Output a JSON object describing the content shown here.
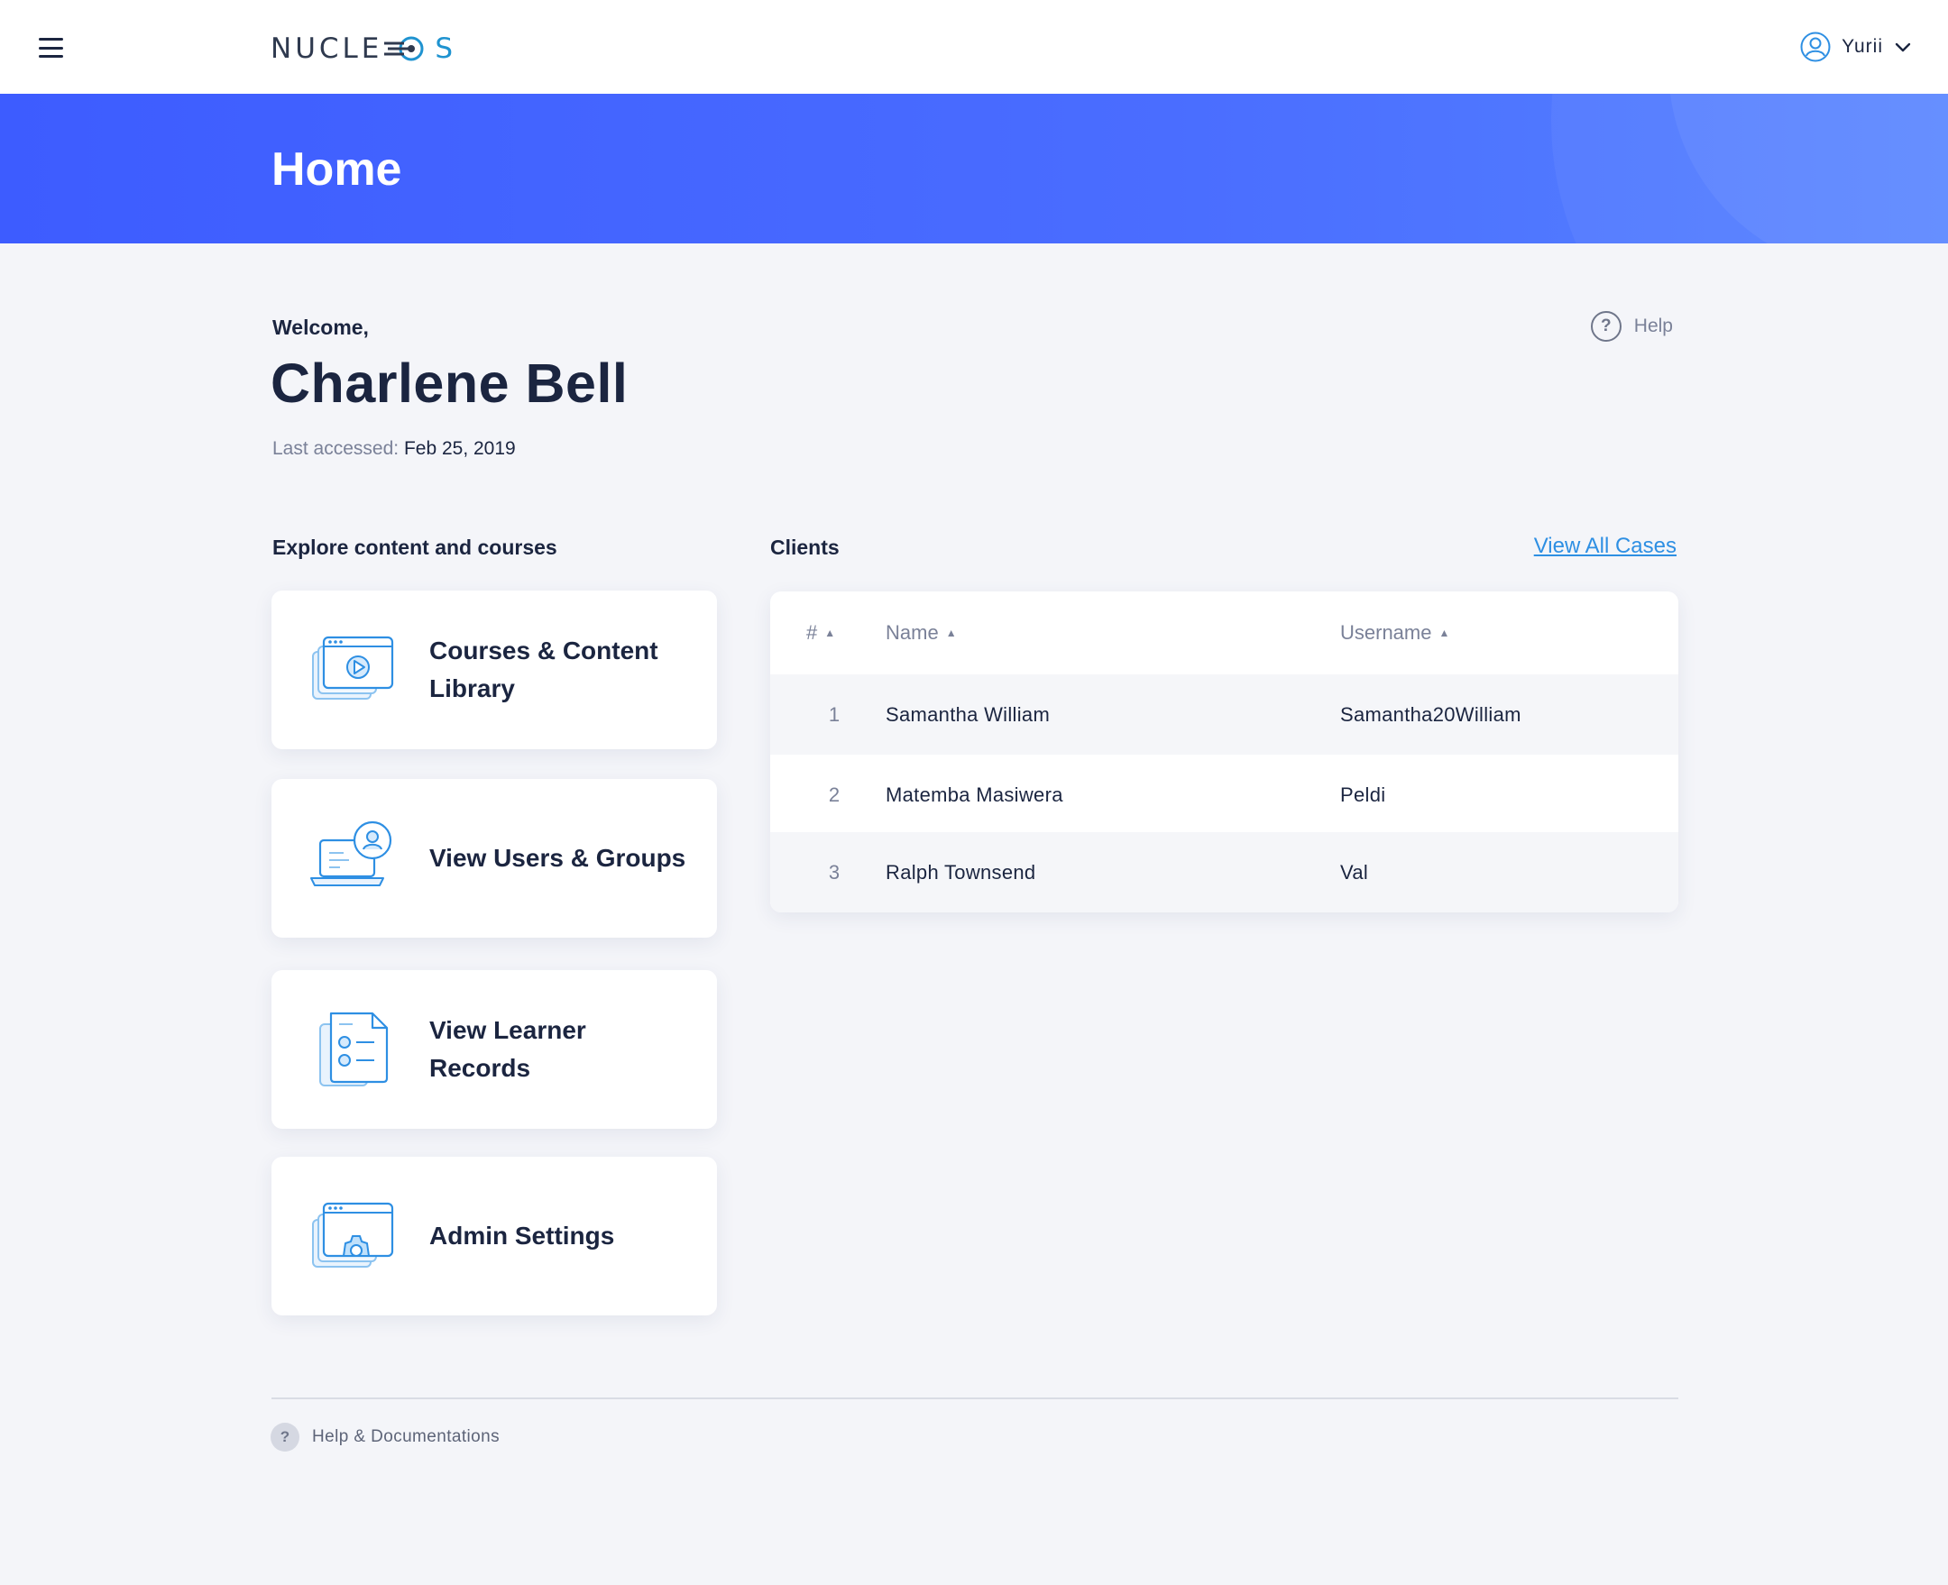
{
  "app": {
    "logo_text_main": "NUCLE",
    "logo_text_tail": "S"
  },
  "header": {
    "user_name": "Yurii"
  },
  "hero": {
    "title": "Home"
  },
  "welcome": {
    "label": "Welcome,",
    "full_name": "Charlene Bell",
    "last_accessed_label": "Last accessed:",
    "last_accessed_value": "Feb 25, 2019",
    "help_label": "Help"
  },
  "explore": {
    "heading": "Explore content and courses",
    "tiles": [
      {
        "label": "Courses & Content Library",
        "icon": "video-library-icon"
      },
      {
        "label": "View Users & Groups",
        "icon": "users-laptop-icon"
      },
      {
        "label": "View Learner Records",
        "icon": "learner-records-icon"
      },
      {
        "label": "Admin Settings",
        "icon": "admin-settings-icon"
      }
    ]
  },
  "clients": {
    "heading": "Clients",
    "view_all_label": "View All Cases",
    "columns": {
      "num": "#",
      "name": "Name",
      "username": "Username"
    },
    "rows": [
      {
        "num": "1",
        "name": "Samantha William",
        "username": "Samantha20William"
      },
      {
        "num": "2",
        "name": "Matemba Masiwera",
        "username": "Peldi"
      },
      {
        "num": "3",
        "name": "Ralph Townsend",
        "username": "Val"
      }
    ]
  },
  "footer": {
    "help_docs_label": "Help & Documentations"
  },
  "colors": {
    "accent": "#3d5cff",
    "link": "#2e8fe3",
    "text_primary": "#1b2540",
    "text_muted": "#7a8198",
    "background": "#f4f5f9"
  }
}
